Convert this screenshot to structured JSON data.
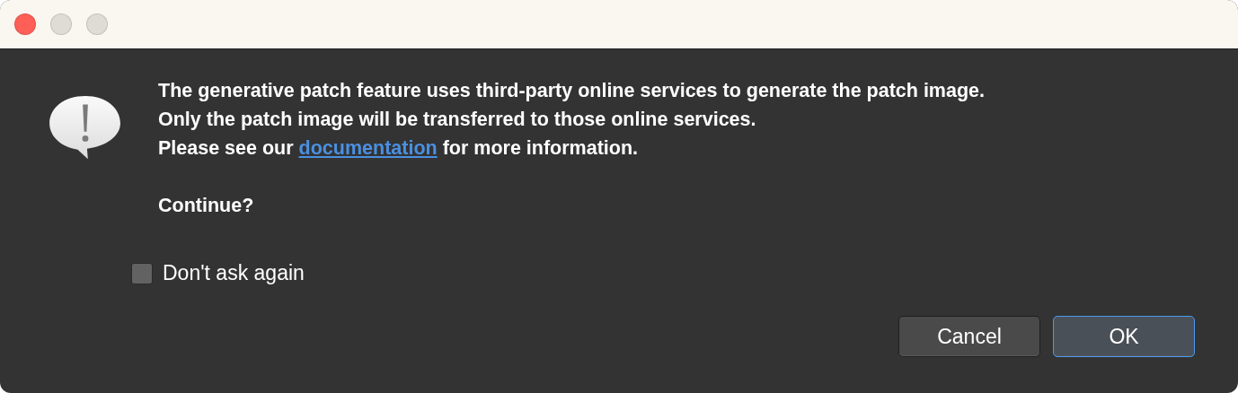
{
  "window": {
    "controls": [
      {
        "kind": "close"
      },
      {
        "kind": "minimize"
      },
      {
        "kind": "zoom"
      }
    ]
  },
  "message": {
    "lines": [
      {
        "text": "The generative patch feature uses third-party online services to generate the patch image."
      },
      {
        "text": "Only the patch image will be transferred to those online services."
      },
      {
        "before": "Please see our ",
        "link": "documentation",
        "after": " for more information."
      }
    ],
    "question": "Continue?"
  },
  "checkbox": {
    "label": "Don't ask again",
    "checked": false
  },
  "buttons": [
    {
      "label": "Cancel",
      "default": false
    },
    {
      "label": "OK",
      "default": true
    }
  ]
}
